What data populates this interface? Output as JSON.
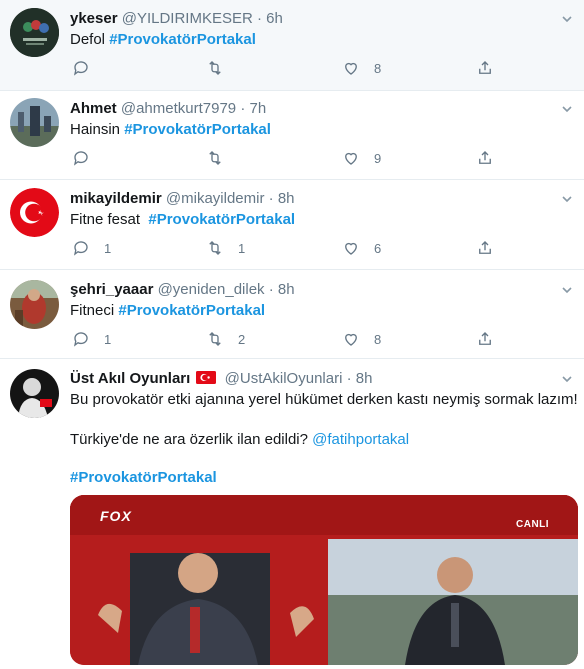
{
  "tweets": [
    {
      "name": "ykeser",
      "handle": "@YILDIRIMKESER",
      "sep": "·",
      "time": "6h",
      "text": "Defol ",
      "hashtag": "#ProvokatörPortakal",
      "reply": "",
      "retweet": "",
      "like": "8"
    },
    {
      "name": "Ahmet",
      "handle": "@ahmetkurt7979",
      "sep": "·",
      "time": "7h",
      "text": "Hainsin ",
      "hashtag": "#ProvokatörPortakal",
      "reply": "",
      "retweet": "",
      "like": "9"
    },
    {
      "name": "mikayildemir",
      "handle": "@mikayildemir",
      "sep": "·",
      "time": "8h",
      "text": "Fitne fesat  ",
      "hashtag": "#ProvokatörPortakal",
      "reply": "1",
      "retweet": "1",
      "like": "6"
    },
    {
      "name": "şehri_yaaar",
      "handle": "@yeniden_dilek",
      "sep": "·",
      "time": "8h",
      "text": "Fitneci ",
      "hashtag": "#ProvokatörPortakal",
      "reply": "1",
      "retweet": "2",
      "like": "8"
    }
  ],
  "last": {
    "name": "Üst Akıl Oyunları",
    "handle": "@UstAkilOyunlari",
    "sep": "·",
    "time": "8h",
    "line1": "Bu provokatör etki ajanına yerel hükümet derken kastı neymiş sormak lazım!",
    "line2": "Türkiye'de ne ara özerlik ilan edildi? ",
    "mention": "@fatihportakal",
    "hashtag": "#ProvokatörPortakal",
    "media": {
      "logo": "FOX",
      "live": "CANLI"
    }
  }
}
